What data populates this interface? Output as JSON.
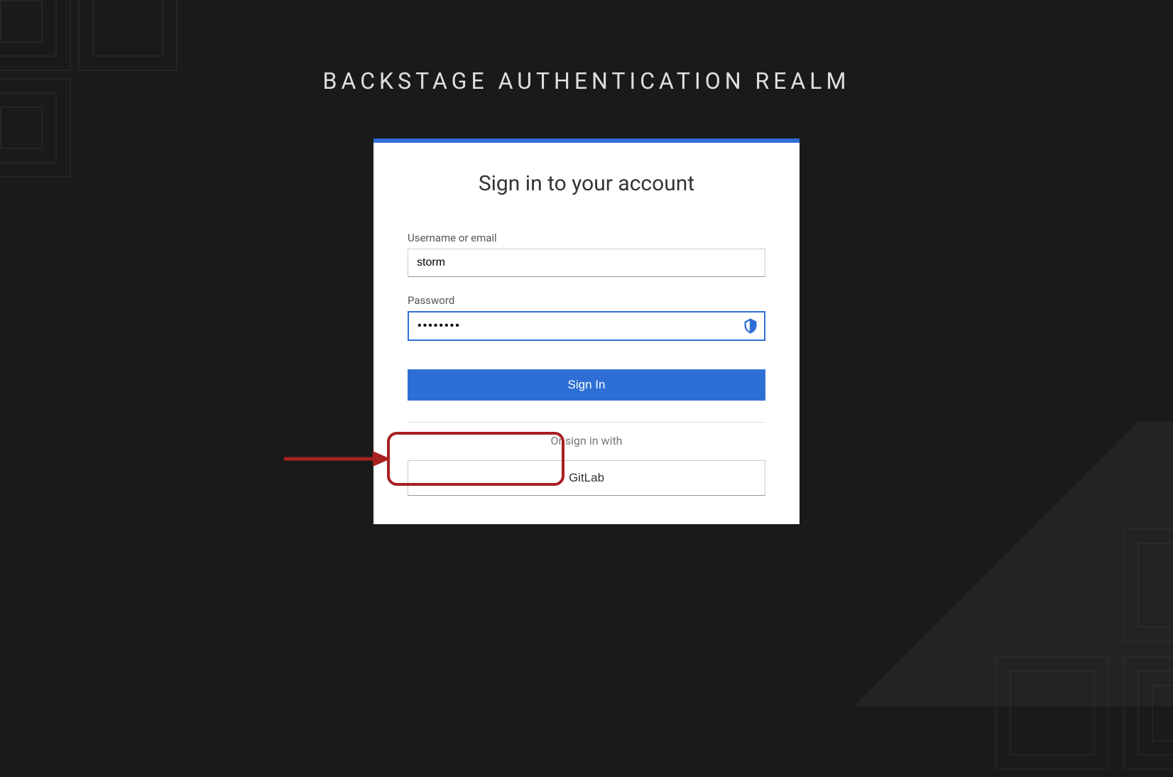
{
  "page": {
    "title": "BACKSTAGE AUTHENTICATION REALM"
  },
  "card": {
    "heading": "Sign in to your account"
  },
  "form": {
    "username_label": "Username or email",
    "username_value": "storm",
    "password_label": "Password",
    "password_value": "••••••••",
    "signin_label": "Sign In"
  },
  "oauth": {
    "divider_text": "Or sign in with",
    "provider_label": "GitLab"
  },
  "colors": {
    "accent": "#2e6fd6",
    "annotation": "#a82020",
    "background": "#1a1a1a"
  }
}
